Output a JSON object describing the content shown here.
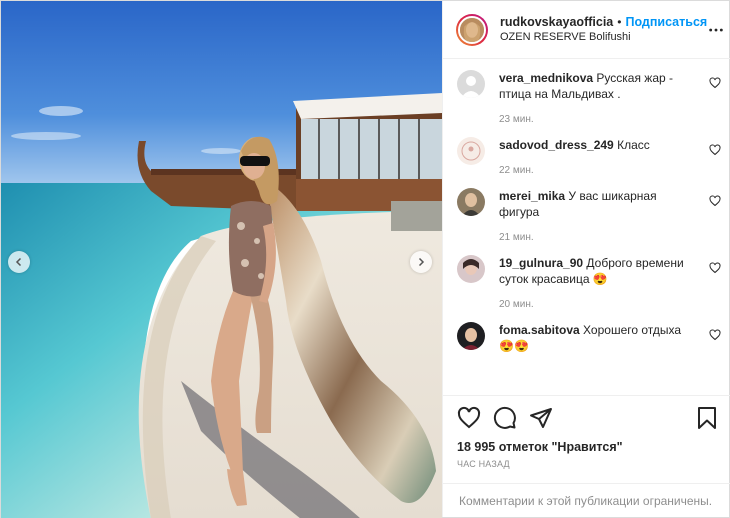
{
  "header": {
    "username": "rudkovskayaofficia",
    "separator": "•",
    "follow_label": "Подписаться",
    "location": "OZEN RESERVE Bolifushi"
  },
  "comments": [
    {
      "user": "vera_mednikova",
      "text": "Русская жар - птица на Мальдивах .",
      "time": "23 мин."
    },
    {
      "user": "sadovod_dress_249",
      "text": "Класс",
      "time": "22 мин."
    },
    {
      "user": "merei_mika",
      "text": "У вас шикарная фигура",
      "time": "21 мин."
    },
    {
      "user": "19_gulnura_90",
      "text": "Доброго времени суток красавица 😍",
      "time": "20 мин."
    },
    {
      "user": "foma.sabitova",
      "text": "Хорошего отдыха 😍😍",
      "time": ""
    }
  ],
  "likes": "18 995 отметок \"Нравится\"",
  "time_ago": "ЧАС НАЗАД",
  "comments_limited": "Комментарии к этой публикации ограничены.",
  "icons": {
    "like": "heart-icon",
    "comment": "comment-icon",
    "share": "share-icon",
    "save": "bookmark-icon",
    "more": "more-icon"
  },
  "colors": {
    "follow": "#0095f6",
    "secondary_text": "#8e8e8e",
    "border": "#efefef"
  }
}
